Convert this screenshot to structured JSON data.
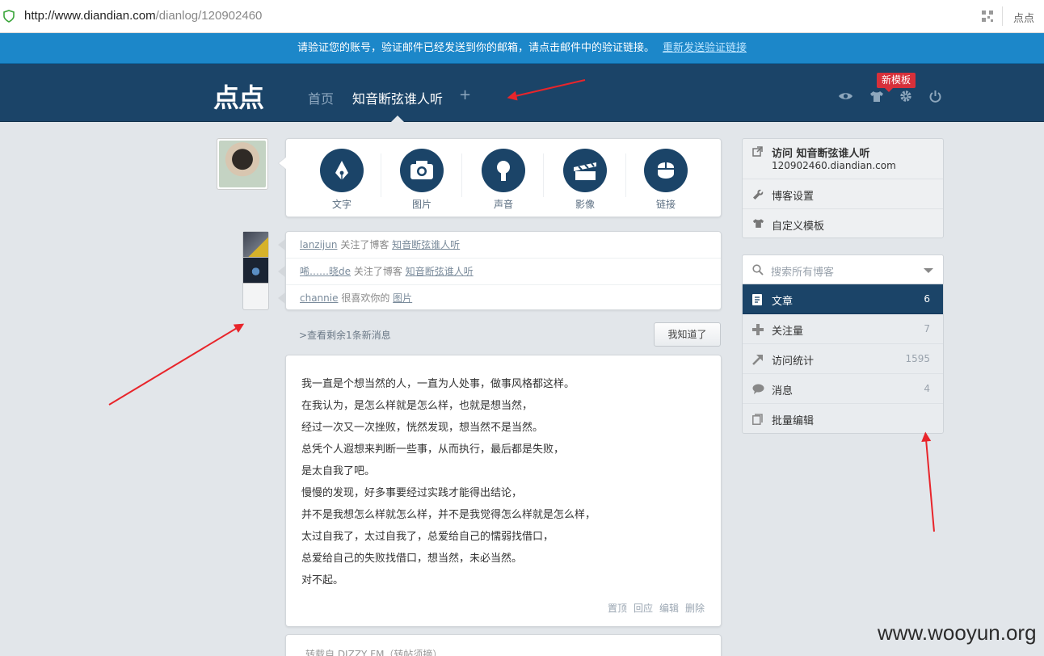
{
  "browser": {
    "url_host": "http://www.diandian.com",
    "url_path": "/dianlog/120902460",
    "extension_label": "点点"
  },
  "notice": {
    "text": "请验证您的账号，验证邮件已经发送到你的邮箱，请点击邮件中的验证链接。",
    "link": "重新发送验证链接"
  },
  "nav": {
    "logo": "点点",
    "home": "首页",
    "blog": "知音断弦谁人听",
    "plus": "+",
    "badge": "新模板"
  },
  "post_types": [
    {
      "label": "文字",
      "icon": "pen-icon"
    },
    {
      "label": "图片",
      "icon": "camera-icon"
    },
    {
      "label": "声音",
      "icon": "microphone-icon"
    },
    {
      "label": "影像",
      "icon": "clapper-icon"
    },
    {
      "label": "链接",
      "icon": "mouse-icon"
    }
  ],
  "notifications": [
    {
      "user": "lanzijun",
      "action": "关注了博客",
      "target": "知音断弦谁人听"
    },
    {
      "user": "唏……晓de",
      "action": "关注了博客",
      "target": "知音断弦谁人听"
    },
    {
      "user": "channie",
      "action": "很喜欢你的",
      "target": "图片"
    }
  ],
  "more_messages": ">查看剩余1条新消息",
  "got_it": "我知道了",
  "post": {
    "lines": [
      "我一直是个想当然的人，一直为人处事，做事风格都这样。",
      "在我认为，是怎么样就是怎么样，也就是想当然，",
      "经过一次又一次挫败，恍然发现，想当然不是当然。",
      "总凭个人遐想来判断一些事，从而执行，最后都是失败，",
      "是太自我了吧。",
      "慢慢的发现，好多事要经过实践才能得出结论，",
      "并不是我想怎么样就怎么样，并不是我觉得怎么样就是怎么样，",
      "太过自我了，太过自我了，总爱给自己的懦弱找借口，",
      "总爱给自己的失败找借口，想当然，未必当然。",
      "对不起。"
    ],
    "actions": [
      "置顶",
      "回应",
      "编辑",
      "删除"
    ]
  },
  "post2_title": "转载自 DIZZY FM（转帖须摘）",
  "sidebar": {
    "visit_label": "访问 知音断弦谁人听",
    "domain": "120902460.diandian.com",
    "settings": "博客设置",
    "template": "自定义模板",
    "search_placeholder": "搜索所有博客",
    "stats": [
      {
        "label": "文章",
        "count": "6",
        "icon": "document-icon"
      },
      {
        "label": "关注量",
        "count": "7",
        "icon": "plus-icon"
      },
      {
        "label": "访问统计",
        "count": "1595",
        "icon": "trend-arrow-icon"
      },
      {
        "label": "消息",
        "count": "4",
        "icon": "speech-bubble-icon"
      },
      {
        "label": "批量编辑",
        "count": "",
        "icon": "pages-icon"
      }
    ]
  },
  "watermark": "www.wooyun.org",
  "colors": {
    "nav": "#1b4468",
    "notice": "#1c87c9",
    "badge": "#d7303a",
    "arrow": "#e8252b"
  }
}
